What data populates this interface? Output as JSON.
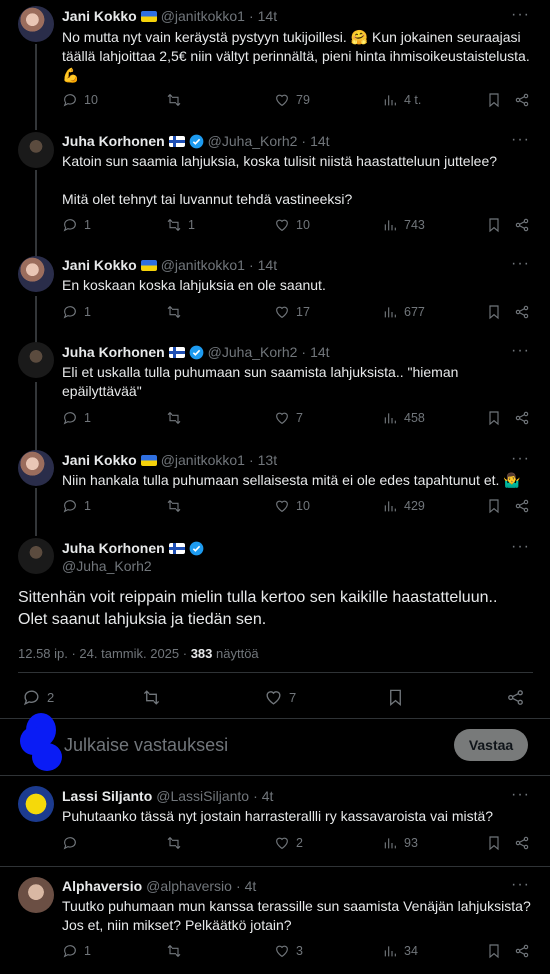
{
  "tweets": [
    {
      "name": "Jani Kokko",
      "handle": "@janitkokko1",
      "time": "14t",
      "flag": "ua",
      "verified": false,
      "text": "No mutta nyt vain keräystä pystyyn tukijoillesi. 🤗 Kun jokainen seuraajasi täällä lahjoittaa 2,5€ niin vältyt perinnältä, pieni hinta ihmisoikeustaistelusta. 💪",
      "replies": "10",
      "retweets": "",
      "likes": "79",
      "views": "4 t."
    },
    {
      "name": "Juha Korhonen",
      "handle": "@Juha_Korh2",
      "time": "14t",
      "flag": "fi",
      "verified": true,
      "text": "Katoin sun saamia lahjuksia, koska tulisit niistä haastatteluun juttelee?\n\nMitä olet tehnyt tai luvannut tehdä vastineeksi?",
      "replies": "1",
      "retweets": "1",
      "likes": "10",
      "views": "743"
    },
    {
      "name": "Jani Kokko",
      "handle": "@janitkokko1",
      "time": "14t",
      "flag": "ua",
      "verified": false,
      "text": "En koskaan koska lahjuksia en ole saanut.",
      "replies": "1",
      "retweets": "",
      "likes": "17",
      "views": "677"
    },
    {
      "name": "Juha Korhonen",
      "handle": "@Juha_Korh2",
      "time": "14t",
      "flag": "fi",
      "verified": true,
      "text": "Eli et uskalla tulla puhumaan sun saamista lahjuksista.. \"hieman epäilyttävää\"",
      "replies": "1",
      "retweets": "",
      "likes": "7",
      "views": "458"
    },
    {
      "name": "Jani Kokko",
      "handle": "@janitkokko1",
      "time": "13t",
      "flag": "ua",
      "verified": false,
      "text": "Niin hankala tulla puhumaan sellaisesta mitä ei ole edes tapahtunut et. 🤷‍♂️",
      "replies": "1",
      "retweets": "",
      "likes": "10",
      "views": "429"
    }
  ],
  "main_tweet": {
    "name": "Juha Korhonen",
    "handle": "@Juha_Korh2",
    "flag": "fi",
    "verified": true,
    "text": "Sittenhän voit reippain mielin tulla kertoo sen kaikille haastatteluun..\nOlet saanut lahjuksia ja tiedän sen.",
    "timestamp": "12.58 ip. · 24. tammik. 2025 · ",
    "views_count": "383",
    "views_label": " näyttöä",
    "replies": "2",
    "retweets": "",
    "likes": "7"
  },
  "reply_box": {
    "placeholder": "Julkaise vastauksesi",
    "button": "Vastaa"
  },
  "replies": [
    {
      "name": "Lassi Siljanto",
      "handle": "@LassiSiljanto",
      "time": "4t",
      "text": "Puhutaanko tässä nyt jostain harrasterallli ry kassavaroista vai mistä?",
      "replies": "",
      "retweets": "",
      "likes": "2",
      "views": "93"
    },
    {
      "name": "Alphaversio",
      "handle": "@alphaversio",
      "time": "4t",
      "text": "Tuutko puhumaan mun kanssa terassille sun saamista Venäjän lahjuksista?\nJos et, niin mikset? Pelkäätkö jotain?",
      "replies": "1",
      "retweets": "",
      "likes": "3",
      "views": "34"
    }
  ],
  "more_icon": "···",
  "colors": {
    "accent": "#1d9bf0",
    "muted": "#71767b",
    "divider": "#2f3336"
  }
}
